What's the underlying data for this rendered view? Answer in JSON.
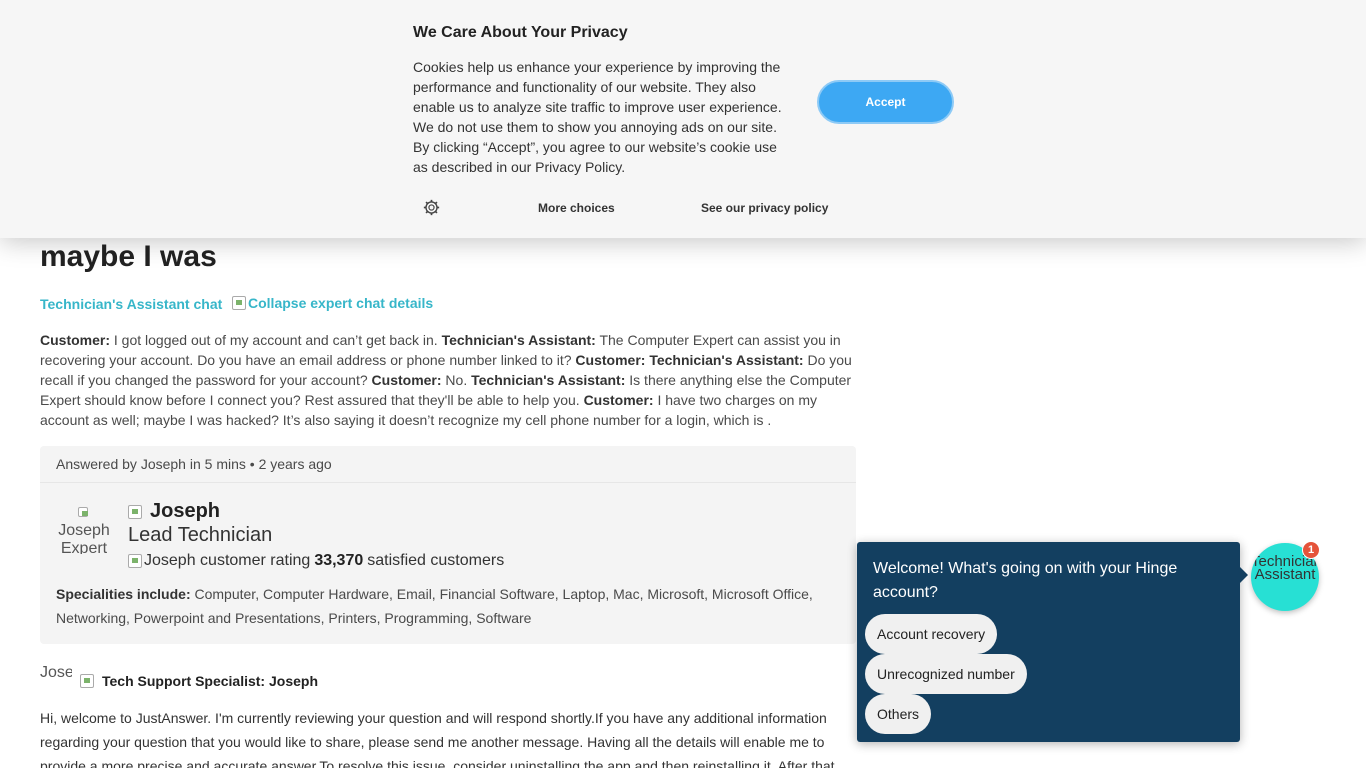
{
  "cookie": {
    "title": "We Care About Your Privacy",
    "text": "Cookies help us enhance your experience by improving the performance and functionality of our website. They also enable us to analyze site traffic to improve user experience. We do not use them to show you annoying ads on our site. By clicking “Accept”, you agree to our website’s cookie use as described in our Privacy Policy.",
    "accept_label": "Accept",
    "more_choices_label": "More choices",
    "privacy_label": "See our privacy policy",
    "accept_color": "#3da8f3"
  },
  "main": {
    "headline": "maybe I was",
    "chat_link": "Technician's Assistant chat",
    "collapse_alt": "Collapse expert chat details",
    "transcript": [
      {
        "speaker": "Customer:",
        "text": " I got logged out of my account and can’t get back in. "
      },
      {
        "speaker": "Technician's Assistant:",
        "text": " The Computer Expert can assist you in recovering your account. Do you have an email address or phone number linked to it? "
      },
      {
        "speaker": "Customer:",
        "text": " "
      },
      {
        "speaker": "Technician's Assistant:",
        "text": " Do you recall if you changed the password for your account? "
      },
      {
        "speaker": "Customer:",
        "text": " No. "
      },
      {
        "speaker": "Technician's Assistant:",
        "text": " Is there anything else the Computer Expert should know before I connect you? Rest assured that they'll be able to help you. "
      },
      {
        "speaker": "Customer:",
        "text": " I have two charges on my account as well; maybe I was hacked? It’s also saying it doesn’t recognize my cell phone number for a login, which is ."
      }
    ]
  },
  "answer": {
    "header": "Answered by Joseph in 5 mins",
    "time": "2 years ago",
    "avatar_alt": "Joseph Expert Pic",
    "name": "Joseph",
    "role": "Lead Technician",
    "rating_alt": "Joseph customer rating",
    "customers_count": "33,370",
    "customers_label": "satisfied customers",
    "specialities_label": "Specialities include:",
    "specialities": "Computer, Computer Hardware, Email, Financial Software, Laptop, Mac, Microsoft, Microsoft Office, Networking, Powerpoint and Presentations, Printers, Programming, Software"
  },
  "message": {
    "avatar_alt": "Joseph",
    "title": "Tech Support Specialist: Joseph",
    "body": "Hi, welcome to JustAnswer. I'm currently reviewing your question and will respond shortly.If you have any additional information regarding your question that you would like to share, please send me another message. Having all the details will enable me to provide a more precise and accurate answer.To resolve this issue, consider uninstalling the app and then reinstalling it. After that"
  },
  "chat_widget": {
    "greeting": "Welcome! What's going on with your Hinge account?",
    "options": [
      "Account recovery",
      "Unrecognized number",
      "Others"
    ],
    "bubble_label": "Technician Assistant",
    "badge_count": "1",
    "panel_color": "#133f60",
    "bubble_color": "#27e0d4"
  }
}
